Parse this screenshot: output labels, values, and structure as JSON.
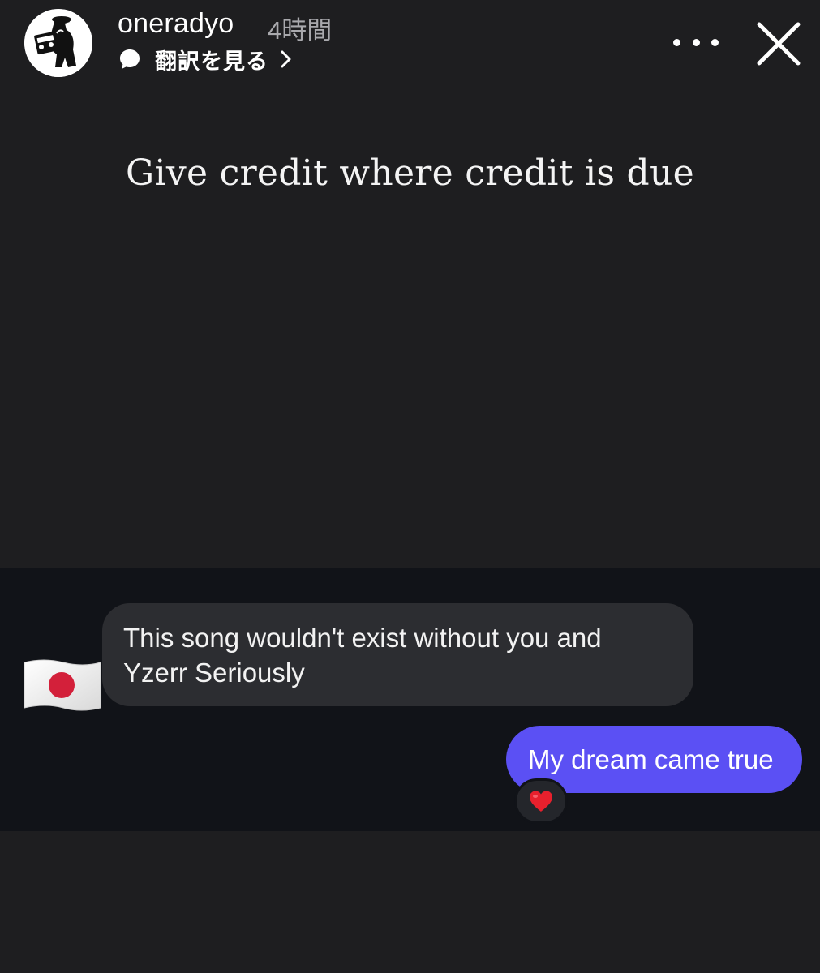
{
  "header": {
    "username": "oneradyo",
    "timestamp": "4時間",
    "translate_label": "翻訳を見る",
    "avatar_icon": "boombox-character-avatar",
    "more_icon": "more-horizontal-icon",
    "close_icon": "close-icon"
  },
  "story": {
    "caption": "Give credit where credit is due"
  },
  "chat": {
    "incoming_message": "This song wouldn't exist without you and Yzerr Seriously",
    "incoming_sender_flag": "japan-flag-icon",
    "outgoing_message": "My dream came true",
    "reaction": "red-heart-icon"
  },
  "colors": {
    "background": "#1e1e20",
    "chat_panel": "#111318",
    "incoming_bubble": "#2c2d31",
    "outgoing_bubble": "#5b50f4",
    "heart": "#e8202d",
    "flag_circle": "#d3203a"
  }
}
